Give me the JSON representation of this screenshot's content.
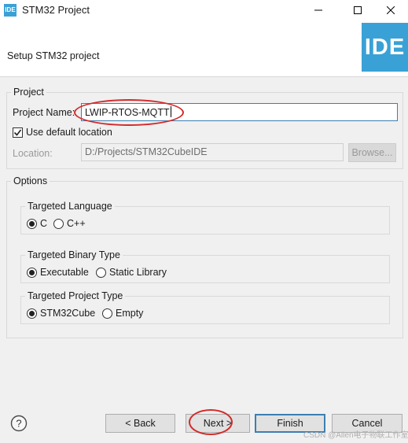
{
  "window": {
    "app_icon_text": "IDE",
    "title": "STM32 Project",
    "minimize_icon": "minimize-icon",
    "maximize_icon": "maximize-icon",
    "close_icon": "close-icon"
  },
  "banner": {
    "heading": "Setup STM32 project",
    "logo_text": "IDE",
    "logo_color": "#3aa1d6"
  },
  "project": {
    "group_title": "Project",
    "name_label": "Project Name:",
    "name_value": "LWIP-RTOS-MQTT",
    "use_default_label": "Use default location",
    "use_default_checked": true,
    "location_label": "Location:",
    "location_value": "D:/Projects/STM32CubeIDE",
    "browse_label": "Browse..."
  },
  "options": {
    "group_title": "Options",
    "language": {
      "title": "Targeted Language",
      "options": [
        "C",
        "C++"
      ],
      "selected": "C"
    },
    "binary": {
      "title": "Targeted Binary Type",
      "options": [
        "Executable",
        "Static Library"
      ],
      "selected": "Executable"
    },
    "project_type": {
      "title": "Targeted Project Type",
      "options": [
        "STM32Cube",
        "Empty"
      ],
      "selected": "STM32Cube"
    }
  },
  "footer": {
    "help_icon": "help-icon",
    "back_label": "< Back",
    "next_label": "Next >",
    "finish_label": "Finish",
    "cancel_label": "Cancel"
  },
  "annotation_color": "#d42a2a",
  "watermark": "CSDN @Allen电子物联工作室"
}
